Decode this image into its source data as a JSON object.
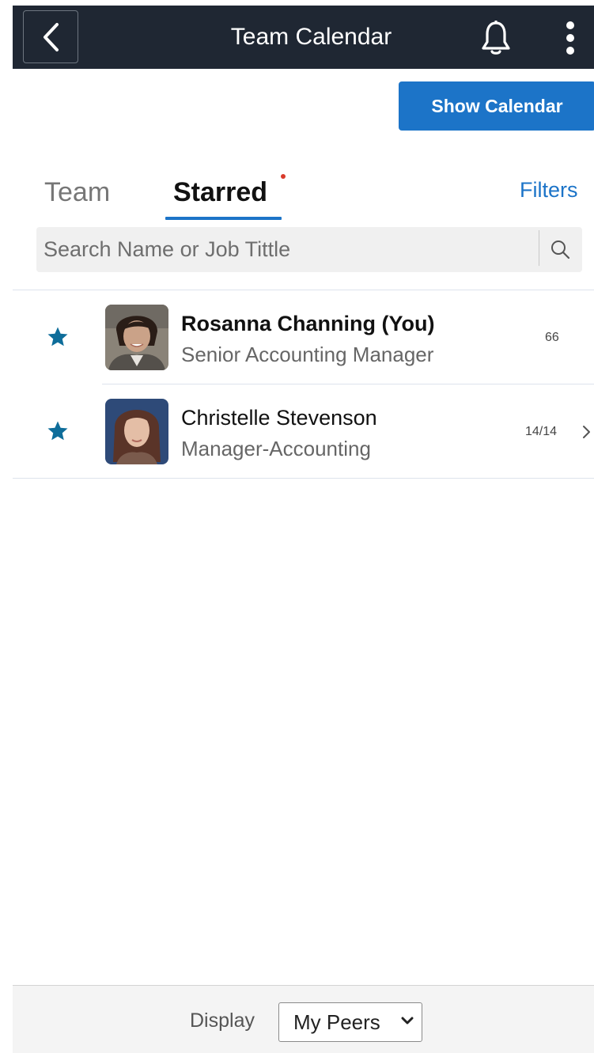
{
  "header": {
    "title": "Team Calendar",
    "back_icon": "chevron-left-icon",
    "notification_icon": "bell-icon",
    "more_icon": "vertical-ellipsis-icon",
    "background": "#1f2733"
  },
  "toolbar": {
    "show_calendar_label": "Show Calendar",
    "accent": "#1c74c8"
  },
  "tabs": {
    "items": [
      {
        "label": "Team",
        "active": false
      },
      {
        "label": "Starred",
        "active": true,
        "has_notification_dot": true
      }
    ],
    "filters_label": "Filters"
  },
  "search": {
    "placeholder": "Search Name or Job Tittle",
    "value": "",
    "icon": "search-icon"
  },
  "people": [
    {
      "name": "Rosanna Channing (You)",
      "title": "Senior Accounting Manager",
      "count": "66",
      "starred": true,
      "has_chevron": false
    },
    {
      "name": "Christelle Stevenson",
      "title": "Manager-Accounting",
      "count": "14/14",
      "starred": true,
      "has_chevron": true
    }
  ],
  "footer": {
    "display_label": "Display",
    "display_selected": "My Peers"
  },
  "colors": {
    "star": "#0e6d9a",
    "notification_dot": "#d93a2b"
  }
}
